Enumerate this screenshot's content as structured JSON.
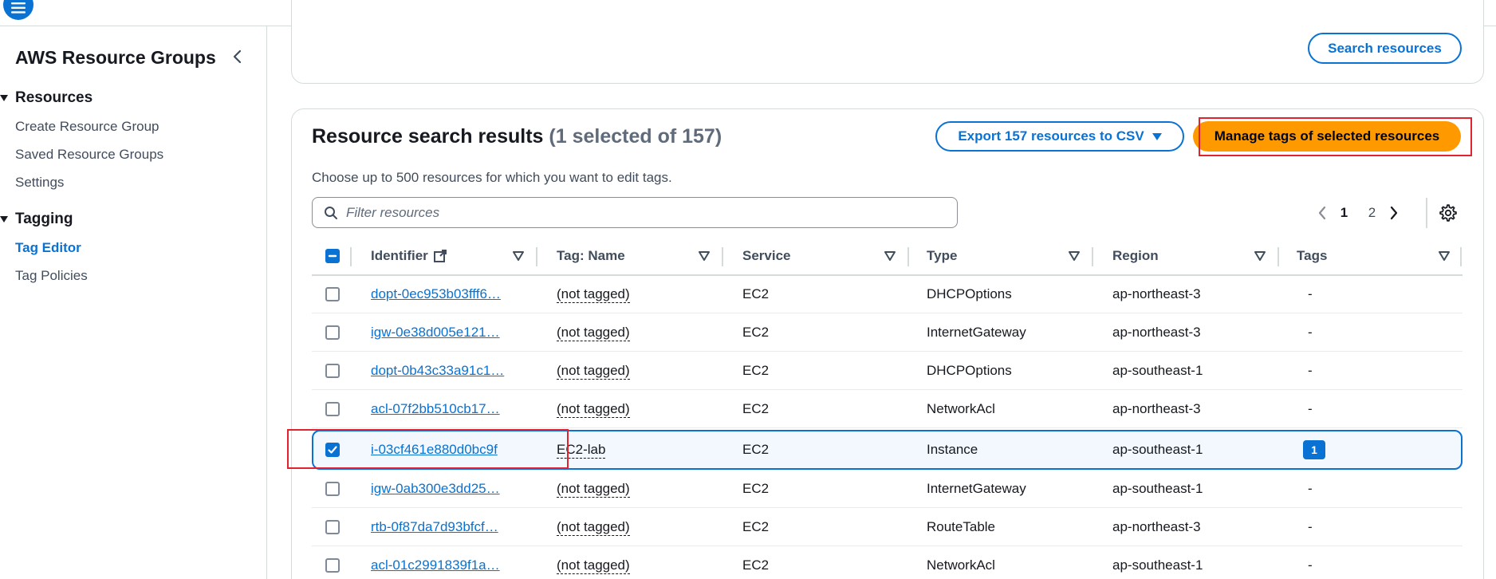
{
  "topbar": {
    "menu_icon": "hamburger-menu-icon",
    "right_icon": "help-hexagon-icon"
  },
  "sidebar": {
    "title": "AWS Resource Groups",
    "collapse_icon": "chevron-left-icon",
    "sections": [
      {
        "label": "Resources",
        "items": [
          {
            "label": "Create Resource Group",
            "active": false
          },
          {
            "label": "Saved Resource Groups",
            "active": false
          },
          {
            "label": "Settings",
            "active": false
          }
        ]
      },
      {
        "label": "Tagging",
        "items": [
          {
            "label": "Tag Editor",
            "active": true
          },
          {
            "label": "Tag Policies",
            "active": false
          }
        ]
      }
    ]
  },
  "search_panel": {
    "search_button": "Search resources"
  },
  "results": {
    "title": "Resource search results",
    "count_text": "(1 selected of 157)",
    "description": "Choose up to 500 resources for which you want to edit tags.",
    "export_button": "Export 157 resources to CSV",
    "manage_button": "Manage tags of selected resources",
    "filter_placeholder": "Filter resources",
    "pagination": {
      "pages": [
        "1",
        "2"
      ],
      "current": "1"
    },
    "columns": [
      "Identifier",
      "Tag: Name",
      "Service",
      "Type",
      "Region",
      "Tags"
    ],
    "rows": [
      {
        "identifier": "dopt-0ec953b03fff6…",
        "tag_name": "(not tagged)",
        "service": "EC2",
        "type": "DHCPOptions",
        "region": "ap-northeast-3",
        "tags": "-",
        "selected": false
      },
      {
        "identifier": "igw-0e38d005e121…",
        "tag_name": "(not tagged)",
        "service": "EC2",
        "type": "InternetGateway",
        "region": "ap-northeast-3",
        "tags": "-",
        "selected": false
      },
      {
        "identifier": "dopt-0b43c33a91c1…",
        "tag_name": "(not tagged)",
        "service": "EC2",
        "type": "DHCPOptions",
        "region": "ap-southeast-1",
        "tags": "-",
        "selected": false
      },
      {
        "identifier": "acl-07f2bb510cb17…",
        "tag_name": "(not tagged)",
        "service": "EC2",
        "type": "NetworkAcl",
        "region": "ap-northeast-3",
        "tags": "-",
        "selected": false
      },
      {
        "identifier": "i-03cf461e880d0bc9f",
        "tag_name": "EC2-lab",
        "service": "EC2",
        "type": "Instance",
        "region": "ap-southeast-1",
        "tags": "1",
        "selected": true
      },
      {
        "identifier": "igw-0ab300e3dd25…",
        "tag_name": "(not tagged)",
        "service": "EC2",
        "type": "InternetGateway",
        "region": "ap-southeast-1",
        "tags": "-",
        "selected": false
      },
      {
        "identifier": "rtb-0f87da7d93bfcf…",
        "tag_name": "(not tagged)",
        "service": "EC2",
        "type": "RouteTable",
        "region": "ap-northeast-3",
        "tags": "-",
        "selected": false
      },
      {
        "identifier": "acl-01c2991839f1a…",
        "tag_name": "(not tagged)",
        "service": "EC2",
        "type": "NetworkAcl",
        "region": "ap-southeast-1",
        "tags": "-",
        "selected": false
      }
    ]
  },
  "colors": {
    "accent": "#0972d3",
    "primary_button": "#ff9900",
    "highlight": "#e0232e"
  }
}
